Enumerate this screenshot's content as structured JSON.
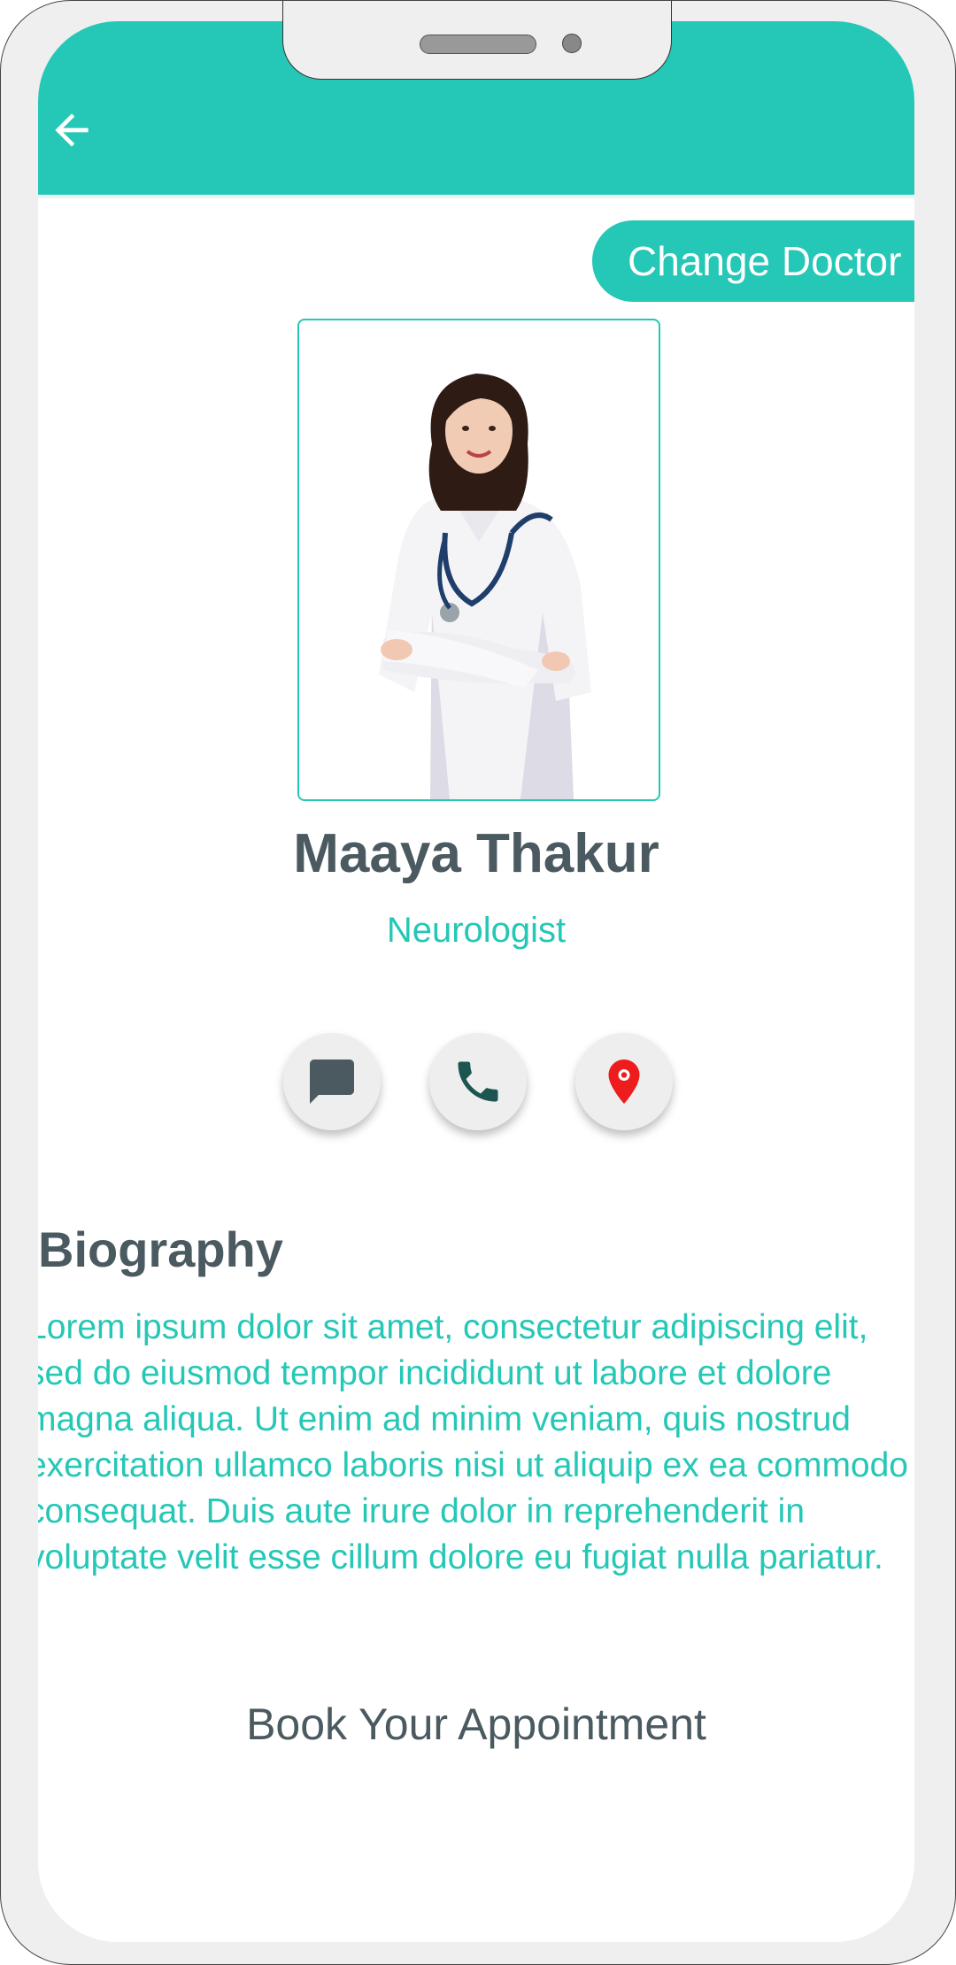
{
  "header": {
    "back_icon": "arrow-left-icon",
    "background_color": "#25c7b6"
  },
  "actions": {
    "change_doctor_label": "Change Doctor"
  },
  "doctor": {
    "name": "Maaya Thakur",
    "specialty": "Neurologist",
    "photo_alt": "Doctor with stethoscope"
  },
  "contact_buttons": [
    {
      "icon": "chat-icon",
      "color": "#4a5a60"
    },
    {
      "icon": "phone-icon",
      "color": "#1d5550"
    },
    {
      "icon": "location-pin-icon",
      "color": "#ee1c1c"
    }
  ],
  "biography": {
    "title": "Biography",
    "text": "Lorem ipsum dolor sit amet, consectetur adipiscing elit, sed do eiusmod tempor incididunt ut labore et dolore magna aliqua. Ut enim ad minim veniam, quis nostrud exercitation ullamco laboris nisi ut aliquip ex ea commodo consequat. Duis aute irure dolor in reprehenderit in voluptate velit esse cillum dolore eu fugiat nulla pariatur."
  },
  "booking": {
    "label": "Book Your Appointment"
  },
  "colors": {
    "accent": "#25c7b6",
    "heading": "#4a5a60"
  }
}
